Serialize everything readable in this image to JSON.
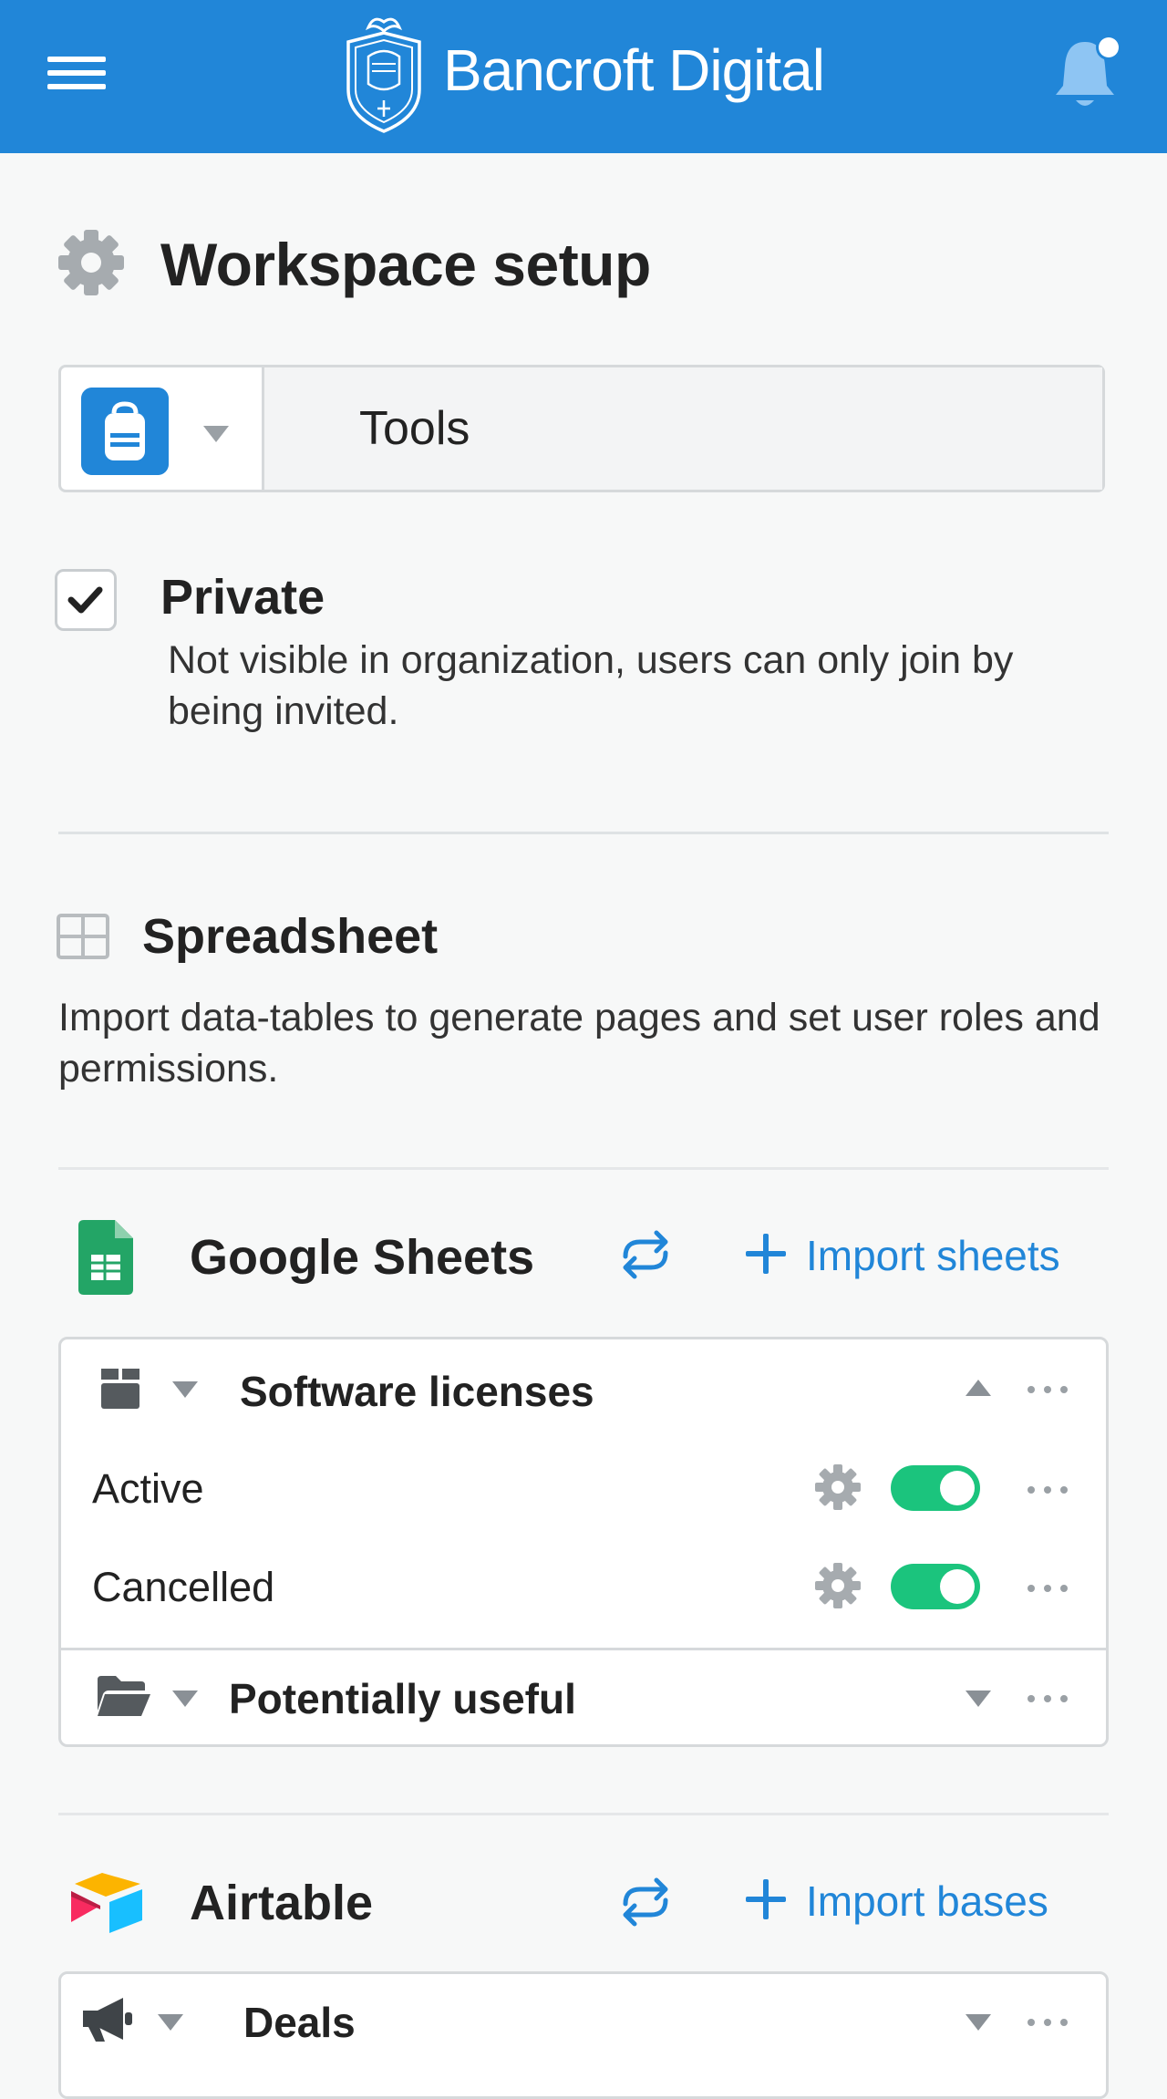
{
  "header": {
    "brand_name": "Bancroft Digital",
    "background_color": "#2186d8",
    "notification_unread": true
  },
  "page": {
    "title": "Workspace setup"
  },
  "workspace": {
    "icon": "backpack-icon",
    "name": "Tools"
  },
  "privacy": {
    "checked": true,
    "label": "Private",
    "description": "Not visible in organization, users can only join by being invited."
  },
  "spreadsheet": {
    "title": "Spreadsheet",
    "description": "Import data-tables to generate pages and set user roles and permissions."
  },
  "sources": [
    {
      "name": "Google Sheets",
      "import_label": "Import sheets",
      "groups": [
        {
          "icon": "box-icon",
          "title": "Software licenses",
          "expanded": true,
          "items": [
            {
              "label": "Active",
              "enabled": true
            },
            {
              "label": "Cancelled",
              "enabled": true
            }
          ]
        },
        {
          "icon": "folder-open-icon",
          "title": "Potentially useful",
          "expanded": false,
          "items": []
        }
      ]
    },
    {
      "name": "Airtable",
      "import_label": "Import bases",
      "groups": [
        {
          "icon": "megaphone-icon",
          "title": "Deals",
          "expanded": false,
          "items": []
        }
      ]
    }
  ],
  "colors": {
    "accent": "#2186d8",
    "toggle_on": "#1bc47d",
    "sheets_green": "#23a566"
  }
}
